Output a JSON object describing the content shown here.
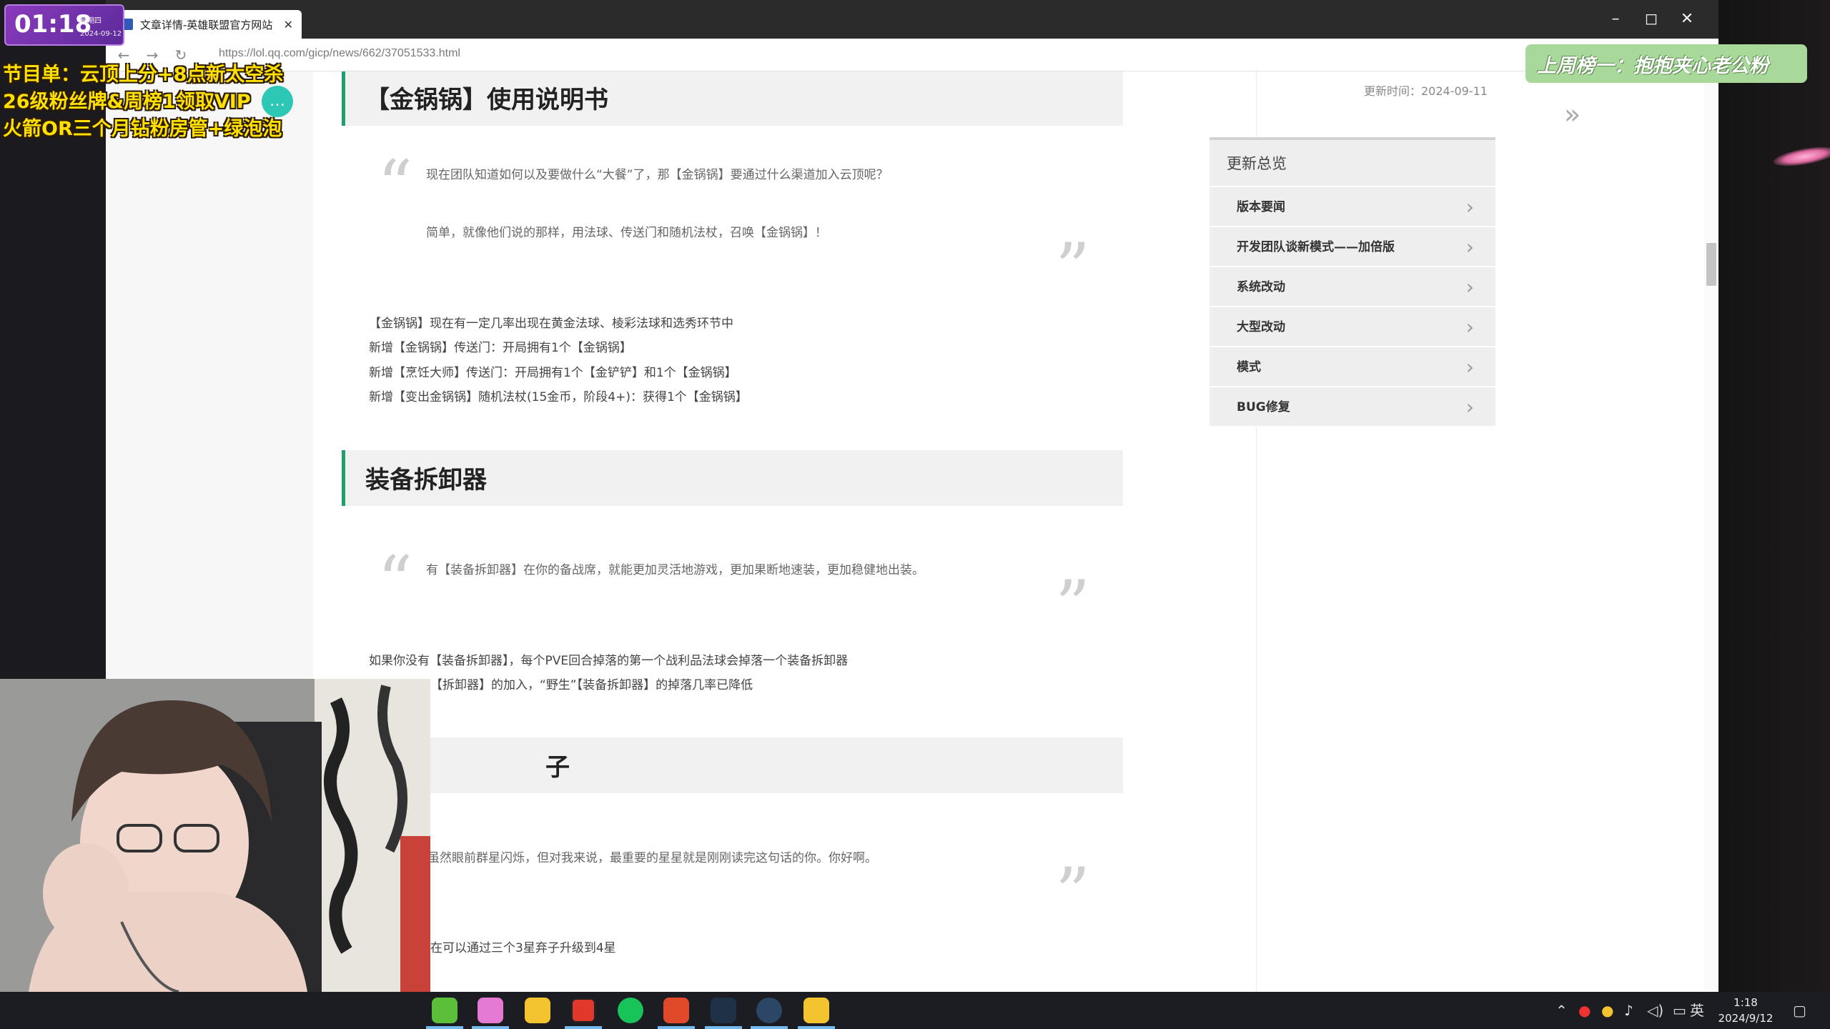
{
  "overlay": {
    "timer": "01:18",
    "timer_sub1": "星期四",
    "timer_sub2": "2024-09-12",
    "lines": [
      "节目单：云顶上分+8点新太空杀",
      "26级粉丝牌&周榜1领取VIP",
      "火箭OR三个月钻粉房管+绿泡泡"
    ],
    "banner": "上周榜一：抱抱夹心老公粉"
  },
  "browser": {
    "tab_title": "文章详情-英雄联盟官方网站",
    "url": "https://lol.qq.com/gicp/news/662/37051533.html"
  },
  "article": {
    "sections": [
      {
        "heading": "【金锅锅】使用说明书",
        "quote": [
          "现在团队知道如何以及要做什么“大餐”了，那【金锅锅】要通过什么渠道加入云顶呢？",
          "简单，就像他们说的那样，用法球、传送门和随机法杖，召唤【金锅锅】！"
        ],
        "paragraphs": [
          "【金锅锅】现在有一定几率出现在黄金法球、棱彩法球和选秀环节中",
          "新增【金锅锅】传送门：开局拥有1个【金锅锅】",
          "新增【烹饪大师】传送门：开局拥有1个【金铲铲】和1个【金锅锅】",
          "新增【变出金锅锅】随机法杖(15金币，阶段4+)：获得1个【金锅锅】"
        ]
      },
      {
        "heading": "装备拆卸器",
        "quote": [
          "有【装备拆卸器】在你的备战席，就能更加灵活地游戏，更加果断地速装，更加稳健地出装。"
        ],
        "paragraphs": [
          "如果你没有【装备拆卸器】，每个PVE回合掉落的第一个战利品法球会掉落一个装备拆卸器",
          "【拆卸器】的加入，“野生”【装备拆卸器】的掉落几率已降低"
        ]
      },
      {
        "heading": "子",
        "quote": [
          "虽然眼前群星闪烁，但对我来说，最重要的星星就是刚刚读完这句话的你。你好啊。"
        ],
        "paragraphs": [
          "在可以通过三个3星弃子升级到4星"
        ]
      }
    ]
  },
  "sidebar": {
    "update_time": "更新时间：2024-09-11",
    "toc_title": "更新总览",
    "toc_items": [
      "版本要闻",
      "开发团队谈新模式——加倍版",
      "系统改动",
      "大型改动",
      "模式",
      "BUG修复"
    ]
  },
  "taskbar": {
    "clock_time": "1:18",
    "clock_date": "2024/9/12",
    "ime": "英",
    "icons": [
      "app-green-icon",
      "app-pink-icon",
      "app-owl-icon",
      "app-g-icon",
      "app-green-arrow-icon",
      "app-red-icon",
      "app-dark-icon",
      "steam-icon",
      "app-owl2-icon"
    ]
  },
  "colors": {
    "accent_green": "#1f9e6e",
    "overlay_yellow": "#ffe000",
    "badge_purple": "#8a3bbd",
    "banner_green": "#a8d89a"
  }
}
